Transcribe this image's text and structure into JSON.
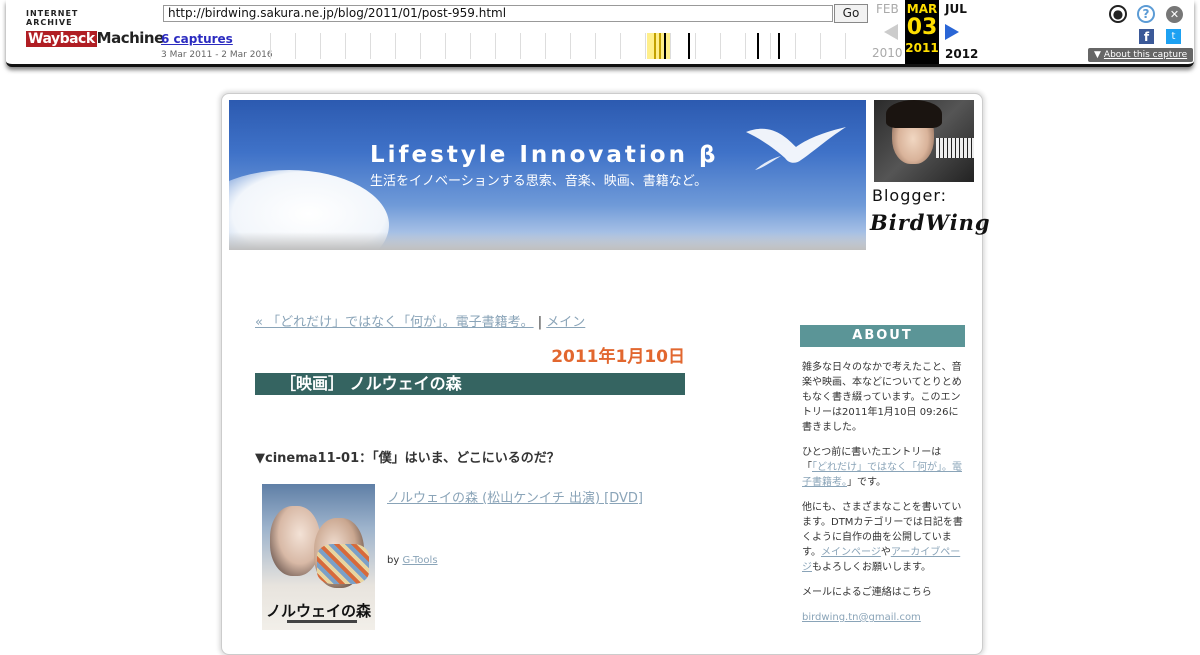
{
  "wayback": {
    "logo_top": "INTERNET ARCHIVE",
    "logo_wayback": "Wayback",
    "logo_machine": "Machine",
    "url": "http://birdwing.sakura.ne.jp/blog/2011/01/post-959.html",
    "go_label": "Go",
    "captures_label": "6 captures",
    "date_range": "3 Mar 2011 - 2 Mar 2016",
    "prev_month": "FEB",
    "current_month": "MAR",
    "next_month": "JUL",
    "current_day": "03",
    "prev_year": "2010",
    "current_year": "2011",
    "next_year": "2012",
    "about_capture": "About this capture",
    "fb_letter": "f",
    "tw_glyph": "t"
  },
  "blog": {
    "title": "Lifestyle Innovation β",
    "subtitle": "生活をイノベーションする思索、音楽、映画、書籍など。",
    "blogger_label": "Blogger:",
    "blogger_signature": "BirdWing"
  },
  "post": {
    "prev_link": "« 「どれだけ」ではなく「何が」。電子書籍考。",
    "separator": "|",
    "main_link": "メイン",
    "date": "2011年1月10日",
    "title": "［映画］ ノルウェイの森",
    "section_heading": "▼cinema11-01：「僕」はいま、どこにいるのだ？",
    "cover_title": "ノルウェイの森",
    "product_link": "ノルウェイの森 (松山ケンイチ 出演) [DVD]",
    "by_prefix": "by",
    "by_link": "G-Tools"
  },
  "sidebar": {
    "about_heading": "ABOUT",
    "p1": "雑多な日々のなかで考えたこと、音楽や映画、本などについてとりとめもなく書き綴っています。このエントリーは2011年1月10日 09:26に書きました。",
    "p2_before": "ひとつ前に書いたエントリーは「",
    "p2_link": "「どれだけ」ではなく「何が」。電子書籍考。",
    "p2_after": "」です。",
    "p3_before": "他にも、さまざまなことを書いています。DTMカテゴリーでは日記を書くように自作の曲を公開しています。",
    "p3_link1": "メインページ",
    "p3_mid": "や",
    "p3_link2": "アーカイブページ",
    "p3_after": "もよろしくお願いします。",
    "p4": "メールによるご連絡はこちら",
    "email": "birdwing.tn@gmail.com"
  },
  "colors": {
    "post_title_bar": "#356461",
    "date_orange": "#e2672f",
    "about_head": "#5b9597",
    "link": "#8aa4b8",
    "wayback_highlight": "#ffde00"
  }
}
